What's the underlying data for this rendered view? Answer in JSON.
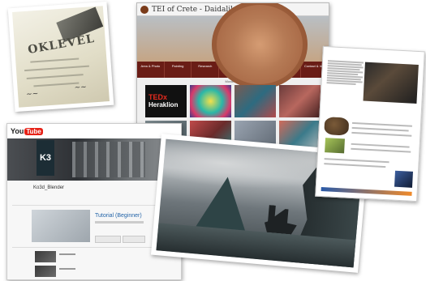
{
  "certificate": {
    "title": "OKLEVÉL"
  },
  "tei_site": {
    "header_title": "TEI of Crete - Daidalika ΣΤΣΤ",
    "nav_items": [
      "Area & Photo",
      "Painting",
      "Research",
      "Photonic Disk",
      "Erasmus Language",
      "Labyrinth",
      "Contact & Info"
    ],
    "section_label": "Movies 3D",
    "tedx_label": "TEDx",
    "tedx_city": "Heraklion"
  },
  "youtube": {
    "logo_text": "You",
    "logo_badge": "Tube",
    "channel_name": "Ko3d_Blender",
    "video_title": "Tutorial (Beginner)"
  },
  "colors": {
    "tei_nav": "#6a1d16",
    "yt_red": "#e62117",
    "tedx_red": "#e62b1e"
  }
}
